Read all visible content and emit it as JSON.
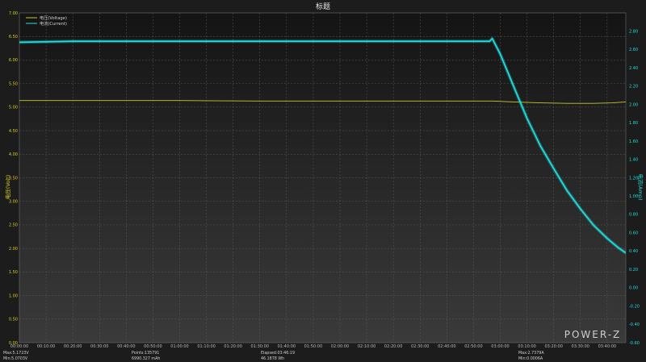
{
  "chart_data": {
    "type": "line",
    "title": "标题",
    "ylabel_left": "电压(Volt)",
    "ylabel_right": "电流(Amp)",
    "ylim_left": [
      0,
      7.0
    ],
    "ylim_right": [
      -0.6,
      3.0
    ],
    "yticks_left": [
      "0.00",
      "0.50",
      "1.00",
      "1.50",
      "2.00",
      "2.50",
      "3.00",
      "3.50",
      "4.00",
      "4.50",
      "5.00",
      "5.50",
      "6.00",
      "6.50",
      "7.00"
    ],
    "yticks_right": [
      "-0.60",
      "-0.40",
      "-0.20",
      "0.00",
      "0.20",
      "0.40",
      "0.60",
      "0.80",
      "1.00",
      "1.20",
      "1.40",
      "1.60",
      "1.80",
      "2.00",
      "2.20",
      "2.40",
      "2.60",
      "2.80"
    ],
    "xticks": [
      "00:00:00",
      "00:10:00",
      "00:20:00",
      "00:30:00",
      "00:40:00",
      "00:50:00",
      "01:00:00",
      "01:10:00",
      "01:20:00",
      "01:30:00",
      "01:40:00",
      "01:50:00",
      "02:00:00",
      "02:10:00",
      "02:20:00",
      "02:30:00",
      "02:40:00",
      "02:50:00",
      "03:00:00",
      "03:10:00",
      "03:20:00",
      "03:30:00",
      "03:40:00"
    ],
    "xlim_minutes": [
      0,
      227
    ],
    "legend": [
      "电压(Voltage)",
      "电流(Current)"
    ],
    "legend_position": "top-left",
    "grid": true,
    "series": [
      {
        "name": "电压(Voltage)",
        "axis": "left",
        "color": "#c8c82a",
        "x_minutes": [
          0,
          30,
          60,
          90,
          120,
          150,
          177,
          185,
          195,
          205,
          215,
          222,
          227
        ],
        "values": [
          5.14,
          5.14,
          5.14,
          5.13,
          5.13,
          5.13,
          5.13,
          5.11,
          5.09,
          5.08,
          5.08,
          5.09,
          5.11
        ]
      },
      {
        "name": "电流(Current)",
        "axis": "right",
        "color": "#22dede",
        "x_minutes": [
          0,
          20,
          60,
          100,
          140,
          176,
          177,
          180,
          185,
          190,
          195,
          200,
          205,
          210,
          215,
          220,
          224,
          227
        ],
        "values": [
          2.68,
          2.69,
          2.69,
          2.69,
          2.69,
          2.69,
          2.72,
          2.55,
          2.2,
          1.85,
          1.55,
          1.3,
          1.06,
          0.86,
          0.68,
          0.54,
          0.44,
          0.38
        ]
      }
    ]
  },
  "logo": "POWER-Z",
  "footer": {
    "max_voltage": "Max:5.1723V",
    "min_voltage": "Min:5.0703V",
    "points": "Points:135791",
    "capacity": "6990.327 mAh",
    "elapsed": "Elapsed:03:46:19",
    "energy": "46.1878 Wh",
    "max_current": "Max:2.7379A",
    "min_current": "Min:0.0006A"
  }
}
